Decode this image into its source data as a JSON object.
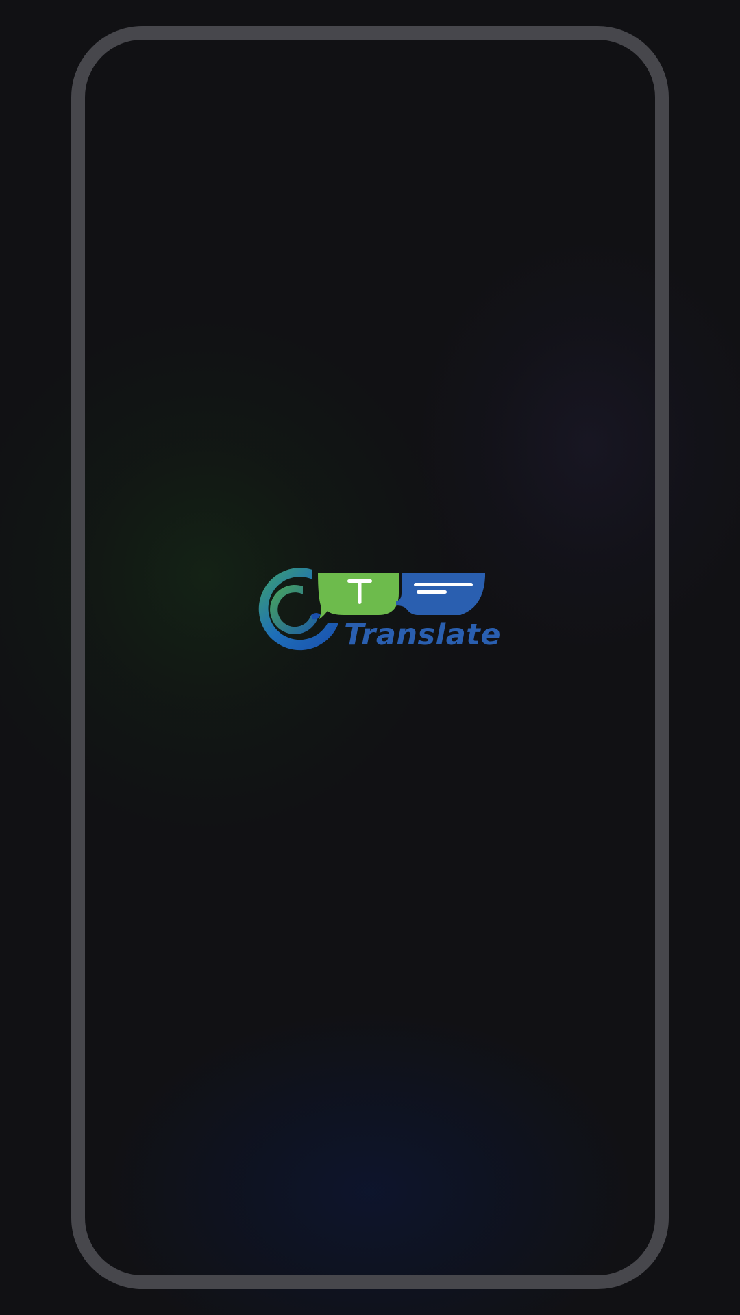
{
  "splash": {
    "brand_name": "Translate",
    "logo_icon": "ct-translate-logo",
    "logo_letter": "T"
  },
  "colors": {
    "background": "#111114",
    "frame": "#47474c",
    "brand_green": "#6dbb4c",
    "brand_blue": "#2a5fb0"
  }
}
